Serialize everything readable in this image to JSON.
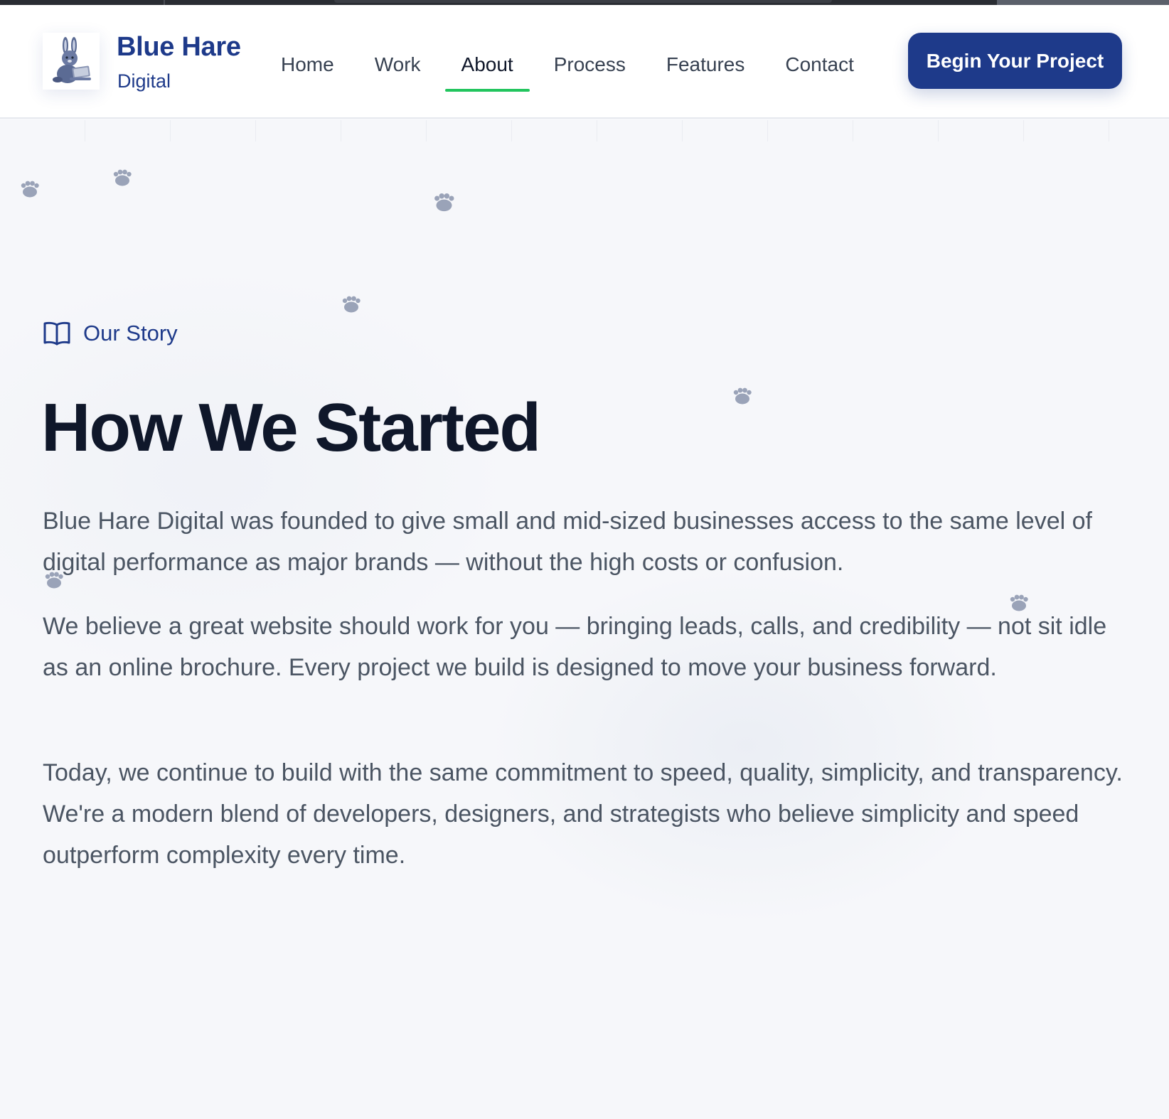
{
  "colors": {
    "brand": "#1e3a8a",
    "active_underline": "#22c55e",
    "heading": "#0f172a",
    "body_text": "#4b5563",
    "paw": "#9aa3b8"
  },
  "header": {
    "logo_icon": "hare-with-laptop-icon",
    "brand_name": "Blue Hare",
    "brand_sub": "Digital",
    "nav": [
      {
        "label": "Home",
        "active": false
      },
      {
        "label": "Work",
        "active": false
      },
      {
        "label": "About",
        "active": true
      },
      {
        "label": "Process",
        "active": false
      },
      {
        "label": "Features",
        "active": false
      },
      {
        "label": "Contact",
        "active": false
      }
    ],
    "cta_label": "Begin Your Project"
  },
  "story": {
    "eyebrow_icon": "open-book-icon",
    "eyebrow": "Our Story",
    "title": "How We Started",
    "paragraphs": [
      "Blue Hare Digital was founded to give small and mid-sized businesses access to the same level of digital performance as major brands — without the high costs or confusion.",
      "We believe a great website should work for you — bringing leads, calls, and credibility — not sit idle as an online brochure. Every project we build is designed to move your business forward.",
      "Today, we continue to build with the same commitment to speed, quality, simplicity, and transparency. We're a modern blend of developers, designers, and strategists who believe simplicity and speed outperform complexity every time."
    ]
  },
  "decor": {
    "paw_icon": "paw-print-icon"
  }
}
